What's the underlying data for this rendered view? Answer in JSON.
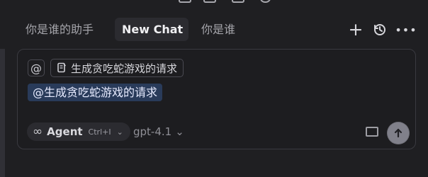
{
  "tabs": [
    {
      "label": "你是谁的助手"
    },
    {
      "label": "New Chat"
    },
    {
      "label": "你是谁"
    }
  ],
  "header": {
    "plus_icon": "plus-icon",
    "history_icon": "history-icon",
    "more_icon": "more-icon"
  },
  "composer": {
    "at_label": "@",
    "context_chip": "生成贪吃蛇游戏的请求",
    "mention_text": "@生成贪吃蛇游戏的请求",
    "agent": {
      "label": "Agent",
      "shortcut": "Ctrl+I"
    },
    "model": "gpt-4.1"
  },
  "colors": {
    "background": "#1f1f22",
    "active_tab": "#2b2b30",
    "mention_pill": "#293b5a",
    "send_button": "#80808a"
  }
}
